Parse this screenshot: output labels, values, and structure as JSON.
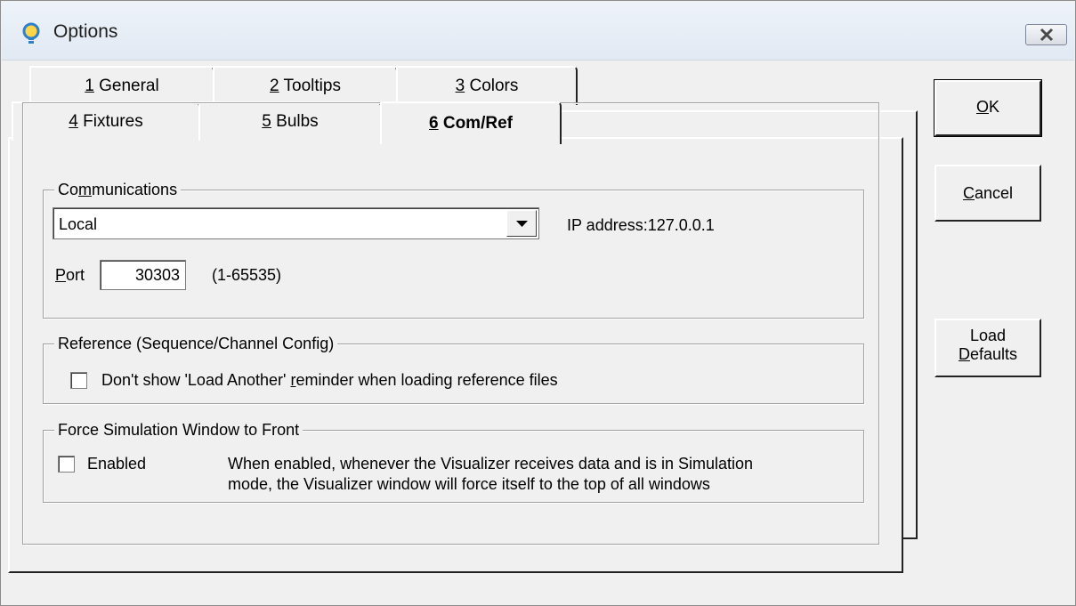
{
  "window": {
    "title": "Options"
  },
  "tabs": {
    "back_row": [
      {
        "num": "1",
        "label": " General"
      },
      {
        "num": "2",
        "label": " Tooltips"
      },
      {
        "num": "3",
        "label": " Colors"
      }
    ],
    "front_row": [
      {
        "num": "4",
        "label": " Fixtures"
      },
      {
        "num": "5",
        "label": " Bulbs"
      },
      {
        "num": "6",
        "label": " Com/Ref"
      }
    ]
  },
  "communications": {
    "group_title_pre": "Co",
    "group_title_mnemonic": "m",
    "group_title_post": "munications",
    "mode_value": "Local",
    "ip_address": "IP address:127.0.0.1",
    "port_mnemonic": "P",
    "port_label_rest": "ort",
    "port_value": "30303",
    "port_range": "(1-65535)"
  },
  "reference": {
    "group_title": "Reference (Sequence/Channel Config)",
    "checkbox_label_pre": "Don't show 'Load Another' ",
    "checkbox_label_mnemonic": "r",
    "checkbox_label_post": "eminder when loading reference files",
    "checked": false
  },
  "force_simulation": {
    "group_title": "Force Simulation Window to Front",
    "enabled_label": "Enabled",
    "checked": false,
    "description_line1": "When enabled, whenever the Visualizer receives data and is in Simulation",
    "description_line2": "mode, the Visualizer window will force itself to the top of all windows"
  },
  "buttons": {
    "ok_mnemonic": "O",
    "ok_rest": "K",
    "cancel_mnemonic": "C",
    "cancel_rest": "ancel",
    "load_defaults_line1": "Load",
    "load_defaults_mnemonic": "D",
    "load_defaults_line2_rest": "efaults"
  },
  "icons": {
    "app": "lightbulb-icon",
    "close": "close-icon",
    "dropdown": "chevron-down-icon"
  }
}
